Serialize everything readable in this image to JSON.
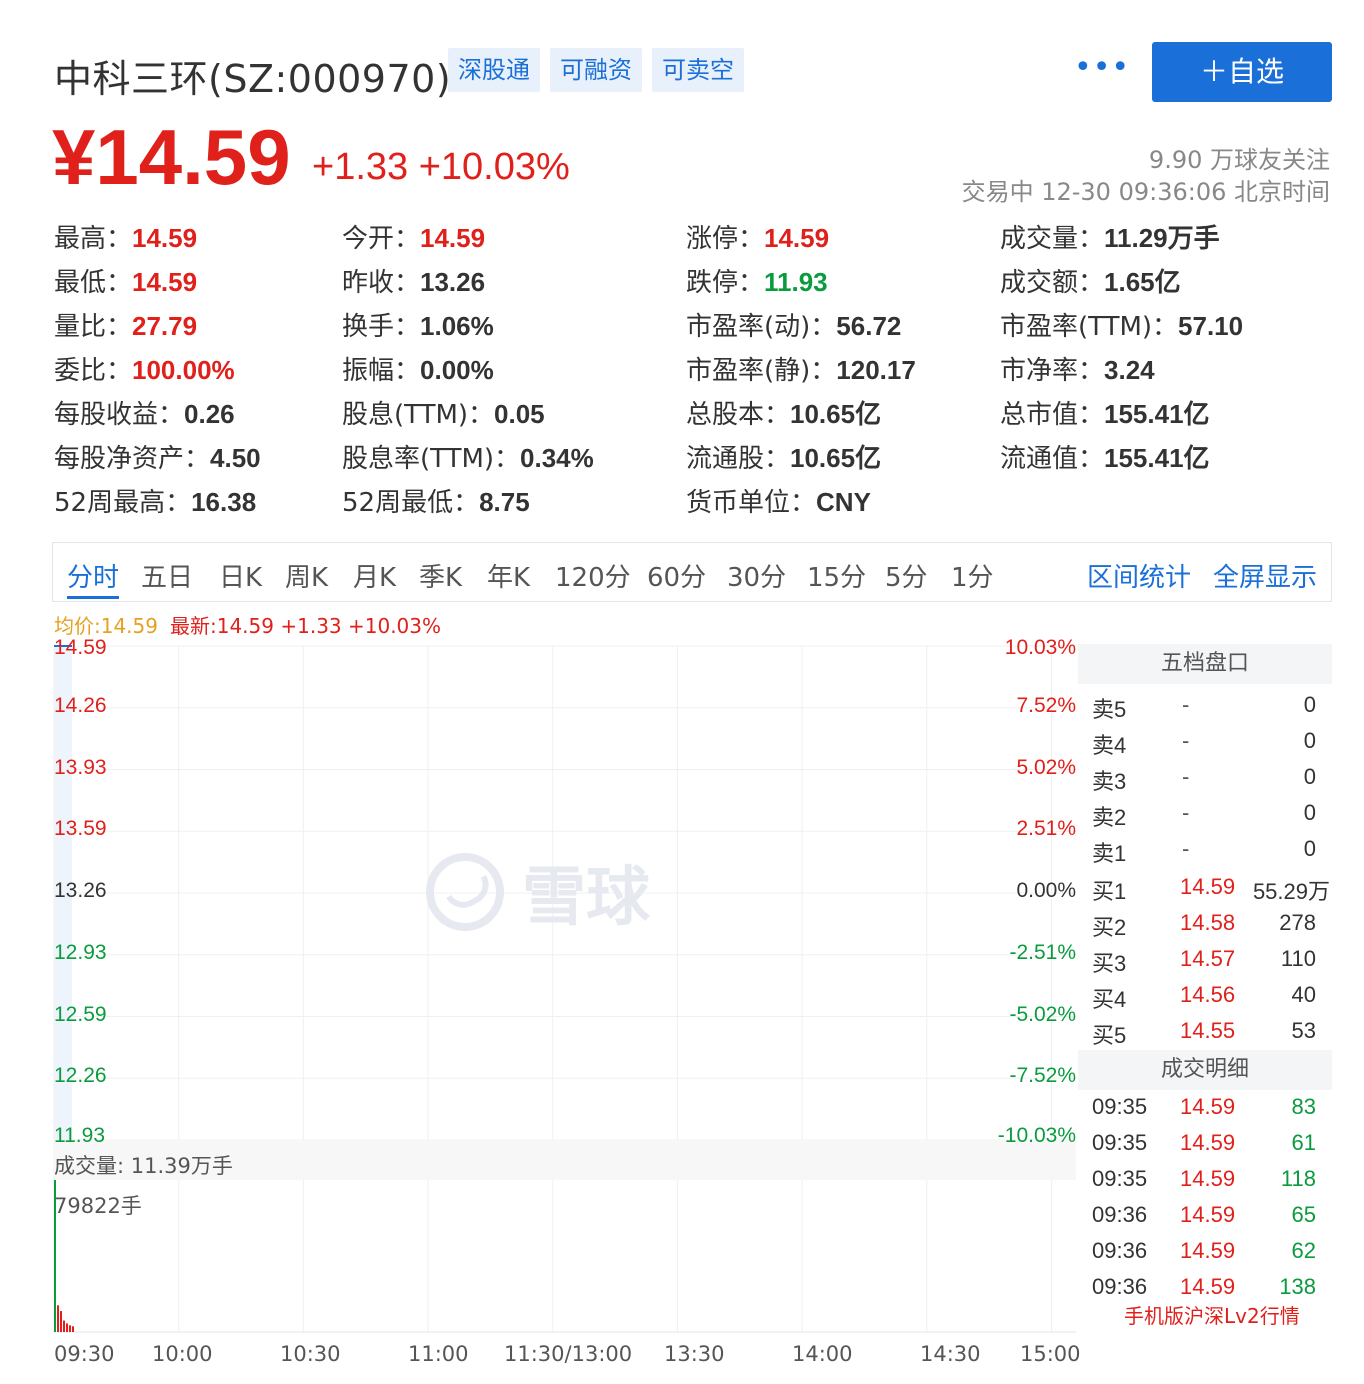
{
  "header": {
    "title": "中科三环(SZ:000970)",
    "tags": [
      "深股通",
      "可融资",
      "可卖空"
    ],
    "more": "•••",
    "follow_button": "＋自选",
    "price": "¥14.59",
    "change": "+1.33 +10.03%",
    "followers": "9.90 万球友关注",
    "trade_status": "交易中 12-30 09:36:06 北京时间"
  },
  "stats": [
    {
      "label": "最高：",
      "value": "14.59",
      "color": "red"
    },
    {
      "label": "今开：",
      "value": "14.59",
      "color": "red"
    },
    {
      "label": "涨停：",
      "value": "14.59",
      "color": "red"
    },
    {
      "label": "成交量：",
      "value": "11.29万手",
      "color": "dark"
    },
    {
      "label": "最低：",
      "value": "14.59",
      "color": "red"
    },
    {
      "label": "昨收：",
      "value": "13.26",
      "color": "dark"
    },
    {
      "label": "跌停：",
      "value": "11.93",
      "color": "green"
    },
    {
      "label": "成交额：",
      "value": "1.65亿",
      "color": "dark"
    },
    {
      "label": "量比：",
      "value": "27.79",
      "color": "red"
    },
    {
      "label": "换手：",
      "value": "1.06%",
      "color": "dark"
    },
    {
      "label": "市盈率(动)：",
      "value": "56.72",
      "color": "dark"
    },
    {
      "label": "市盈率(TTM)：",
      "value": "57.10",
      "color": "dark"
    },
    {
      "label": "委比：",
      "value": "100.00%",
      "color": "red"
    },
    {
      "label": "振幅：",
      "value": "0.00%",
      "color": "dark"
    },
    {
      "label": "市盈率(静)：",
      "value": "120.17",
      "color": "dark"
    },
    {
      "label": "市净率：",
      "value": "3.24",
      "color": "dark"
    },
    {
      "label": "每股收益：",
      "value": "0.26",
      "color": "dark"
    },
    {
      "label": "股息(TTM)：",
      "value": "0.05",
      "color": "dark"
    },
    {
      "label": "总股本：",
      "value": "10.65亿",
      "color": "dark"
    },
    {
      "label": "总市值：",
      "value": "155.41亿",
      "color": "dark"
    },
    {
      "label": "每股净资产：",
      "value": "4.50",
      "color": "dark"
    },
    {
      "label": "股息率(TTM)：",
      "value": "0.34%",
      "color": "dark"
    },
    {
      "label": "流通股：",
      "value": "10.65亿",
      "color": "dark"
    },
    {
      "label": "流通值：",
      "value": "155.41亿",
      "color": "dark"
    },
    {
      "label": "52周最高：",
      "value": "16.38",
      "color": "dark"
    },
    {
      "label": "52周最低：",
      "value": "8.75",
      "color": "dark"
    },
    {
      "label": "货币单位：",
      "value": "CNY",
      "color": "dark"
    }
  ],
  "tabs": [
    "分时",
    "五日",
    "日K",
    "周K",
    "月K",
    "季K",
    "年K",
    "120分",
    "60分",
    "30分",
    "15分",
    "5分",
    "1分"
  ],
  "tab_actions": [
    "区间统计",
    "全屏显示"
  ],
  "legend": {
    "avg": "均价:14.59",
    "latest": "最新:14.59 +1.33 +10.03%"
  },
  "watermark": "雪球",
  "chart_data": {
    "type": "line",
    "title": "",
    "y_price_ticks": [
      "14.59",
      "14.26",
      "13.93",
      "13.59",
      "13.26",
      "12.93",
      "12.59",
      "12.26",
      "11.93"
    ],
    "y_pct_ticks": [
      "10.03%",
      "7.52%",
      "5.02%",
      "2.51%",
      "0.00%",
      "-2.51%",
      "-5.02%",
      "-7.52%",
      "-10.03%"
    ],
    "x_ticks": [
      "09:30",
      "10:00",
      "10:30",
      "11:00",
      "11:30/13:00",
      "13:30",
      "14:00",
      "14:30",
      "15:00"
    ],
    "ylim": [
      11.93,
      14.59
    ],
    "prev_close": 13.26,
    "series": [
      {
        "values": [
          14.59,
          14.59,
          14.59,
          14.59,
          14.59,
          14.59,
          14.59
        ]
      }
    ],
    "volume_label": "成交量: 11.39万手",
    "volume_max_label": "79822手",
    "volume_max": 79822,
    "volume_bars": [
      79822,
      14000,
      11000,
      6000,
      4500,
      3500,
      3000
    ]
  },
  "order_book": {
    "title": "五档盘口",
    "sell": [
      {
        "label": "卖5",
        "price": "-",
        "qty": "0"
      },
      {
        "label": "卖4",
        "price": "-",
        "qty": "0"
      },
      {
        "label": "卖3",
        "price": "-",
        "qty": "0"
      },
      {
        "label": "卖2",
        "price": "-",
        "qty": "0"
      },
      {
        "label": "卖1",
        "price": "-",
        "qty": "0"
      }
    ],
    "buy": [
      {
        "label": "买1",
        "price": "14.59",
        "qty": "55.29万"
      },
      {
        "label": "买2",
        "price": "14.58",
        "qty": "278"
      },
      {
        "label": "买3",
        "price": "14.57",
        "qty": "110"
      },
      {
        "label": "买4",
        "price": "14.56",
        "qty": "40"
      },
      {
        "label": "买5",
        "price": "14.55",
        "qty": "53"
      }
    ],
    "trades_title": "成交明细",
    "trades": [
      {
        "time": "09:35",
        "price": "14.59",
        "qty": "83"
      },
      {
        "time": "09:35",
        "price": "14.59",
        "qty": "61"
      },
      {
        "time": "09:35",
        "price": "14.59",
        "qty": "118"
      },
      {
        "time": "09:36",
        "price": "14.59",
        "qty": "65"
      },
      {
        "time": "09:36",
        "price": "14.59",
        "qty": "62"
      },
      {
        "time": "09:36",
        "price": "14.59",
        "qty": "138"
      }
    ],
    "mobile_link": "手机版沪深Lv2行情"
  }
}
